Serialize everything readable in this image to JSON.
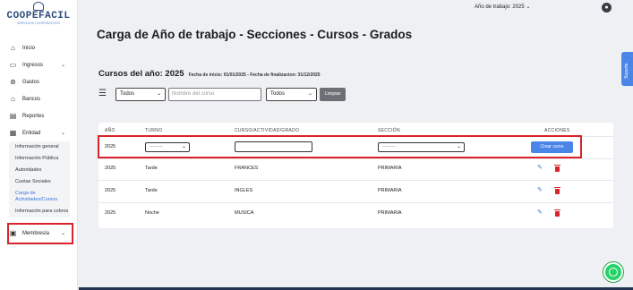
{
  "brand": {
    "name": "COOPEFACIL",
    "tagline": "SERVICIOS COOPERATIVOS"
  },
  "topbar": {
    "work_year": "Año de trabajo: 2025",
    "work_year_chevron": "⌄"
  },
  "sidebar": {
    "items": [
      {
        "label": "Inicio",
        "icon": "home-icon",
        "glyph": "⌂"
      },
      {
        "label": "Ingresos",
        "icon": "cash-icon",
        "glyph": "▭",
        "chevron": "⌄"
      },
      {
        "label": "Gastos",
        "icon": "dollar-icon",
        "glyph": "⊛"
      },
      {
        "label": "Bancos",
        "icon": "bank-icon",
        "glyph": "⌂"
      },
      {
        "label": "Reportes",
        "icon": "report-icon",
        "glyph": "▤"
      },
      {
        "label": "Entidad",
        "icon": "grid-icon",
        "glyph": "▦",
        "chevron": "⌄"
      }
    ],
    "entidad_sub": [
      "Información general",
      "Información Pública",
      "Autoridades",
      "Cuotas Sociales",
      "Carga de Actividades/Cursos",
      "Información para cobros"
    ],
    "membresia": {
      "label": "Membresía",
      "chevron": "⌄"
    }
  },
  "page": {
    "title": "Carga de Año de trabajo - Secciones - Cursos - Grados",
    "courses_heading": "Cursos del año: 2025",
    "courses_meta": "Fecha de inicio: 01/01/2025 - Fecha de finalizacion: 31/12/2025"
  },
  "filters": {
    "select1": "Todos",
    "search_placeholder": "Nombre del curso",
    "select2": "Todos",
    "clear_label": "Limpiar"
  },
  "table": {
    "headers": [
      "AÑO",
      "TURNO",
      "CURSO/ACTIVIDAD/GRADO",
      "SECCIÓN",
      "ACCIONES"
    ],
    "new_row": {
      "year": "2025",
      "turn_placeholder": "---------",
      "section_placeholder": "---------",
      "create_label": "Crear curso"
    },
    "rows": [
      {
        "year": "2025",
        "turn": "Tarde",
        "course": "FRANCES",
        "section": "PRIMARIA"
      },
      {
        "year": "2025",
        "turn": "Tarde",
        "course": "INGLES",
        "section": "PRIMARIA"
      },
      {
        "year": "2025",
        "turn": "Noche",
        "course": "MUSICA",
        "section": "PRIMARIA"
      }
    ]
  },
  "support_label": "Soporte",
  "colors": {
    "accent": "#4a86e8",
    "highlight": "#d9232a",
    "navy": "#20324f"
  }
}
